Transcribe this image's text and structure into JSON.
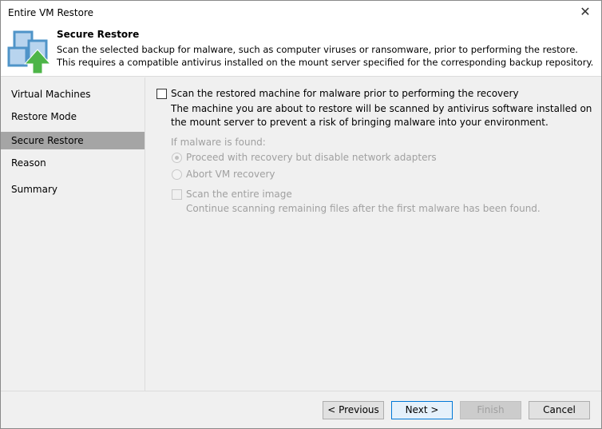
{
  "window": {
    "title": "Entire VM Restore"
  },
  "header": {
    "title": "Secure Restore",
    "description": "Scan the selected backup for malware, such as computer viruses or ransomware, prior to performing the restore. This requires a compatible antivirus installed on the mount server specified for the corresponding backup repository."
  },
  "sidebar": {
    "items": [
      {
        "label": "Virtual Machines"
      },
      {
        "label": "Restore Mode"
      },
      {
        "label": "Secure Restore"
      },
      {
        "label": "Reason"
      },
      {
        "label": "Summary"
      }
    ],
    "selected": "Secure Restore"
  },
  "main": {
    "scan_checkbox": {
      "label": "Scan the restored machine for malware prior to performing the recovery",
      "checked": false
    },
    "scan_description": "The machine you are about to restore will be scanned by antivirus software installed on the mount server to prevent a risk of bringing malware into your environment.",
    "if_found_label": "If malware is found:",
    "options": [
      {
        "label": "Proceed with recovery but disable network adapters",
        "selected": true
      },
      {
        "label": "Abort VM recovery",
        "selected": false
      }
    ],
    "entire_image": {
      "label": "Scan the entire image",
      "checked": false
    },
    "entire_image_description": "Continue scanning remaining files after the first malware has been found."
  },
  "footer": {
    "previous": "< Previous",
    "next": "Next >",
    "finish": "Finish",
    "cancel": "Cancel"
  }
}
